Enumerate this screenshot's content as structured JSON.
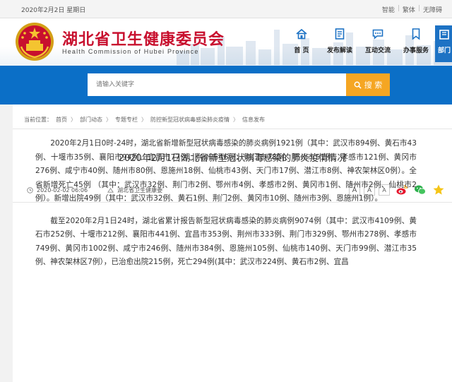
{
  "topbar": {
    "date": "2020年2月2日 星期日",
    "links": [
      "智能",
      "繁体",
      "无障碍"
    ]
  },
  "header": {
    "title": "湖北省卫生健康委员会",
    "subtitle": "Health Commission of Hubei Province"
  },
  "nav": {
    "items": [
      {
        "label": "首 页",
        "icon": "home-icon"
      },
      {
        "label": "发布解读",
        "icon": "document-icon"
      },
      {
        "label": "互动交流",
        "icon": "chat-icon"
      },
      {
        "label": "办事服务",
        "icon": "bookmark-icon"
      },
      {
        "label": "部门",
        "icon": "building-icon"
      }
    ]
  },
  "search": {
    "placeholder": "请输入关键字",
    "button_label": "搜 索"
  },
  "breadcrumb": {
    "label": "当前位置：",
    "items": [
      "首页",
      "部门动态",
      "专题专栏",
      "防控新型冠状病毒感染肺炎疫情",
      "信息发布"
    ]
  },
  "article": {
    "title": "2020年2月1日湖北省新型冠状病毒感染的肺炎疫情情况",
    "date": "2020-02-02 06:06",
    "source": "湖北省卫生健康委",
    "font_buttons": [
      "A",
      "A",
      "A"
    ],
    "paragraphs": [
      "2020年2月1日0时-24时，湖北省新增新型冠状病毒感染的肺炎病例1921例（其中：武汉市894例、黄石市43例、十堰市35例、襄阳市94例、宜昌市77例、荆州市46例、荆门市78例、鄂州市51例、孝感市121例、黄冈市276例、咸宁市40例、随州市80例、恩施州18例、仙桃市43例、天门市17例、潜江市8例、神农架林区0例）。全省新增死亡45例 （其中：武汉市32例、荆门市2例、鄂州市4例、孝感市2例、黄冈市1例、随州市2例、仙桃市2例）。新增出院49例（其中：武汉市32例、黄石1例、荆门2例、黄冈市10例、随州市3例、恩施州1例）。",
      "截至2020年2月1日24时，湖北省累计报告新型冠状病毒感染的肺炎病例9074例（其中：武汉市4109例、黄石市252例、十堰市212例、襄阳市441例、宜昌市353例、荆州市333例、荆门市329例、鄂州市278例、孝感市749例、黄冈市1002例、咸宁市246例、随州市384例、恩施州105例、仙桃市140例、天门市99例、潜江市35例、神农架林区7例），已治愈出院215例，死亡294例(其中：武汉市224例、黄石市2例、宜昌"
    ]
  },
  "colors": {
    "brand_red": "#c8102e",
    "band_blue": "#0b6fc7",
    "search_orange": "#f5a623"
  }
}
